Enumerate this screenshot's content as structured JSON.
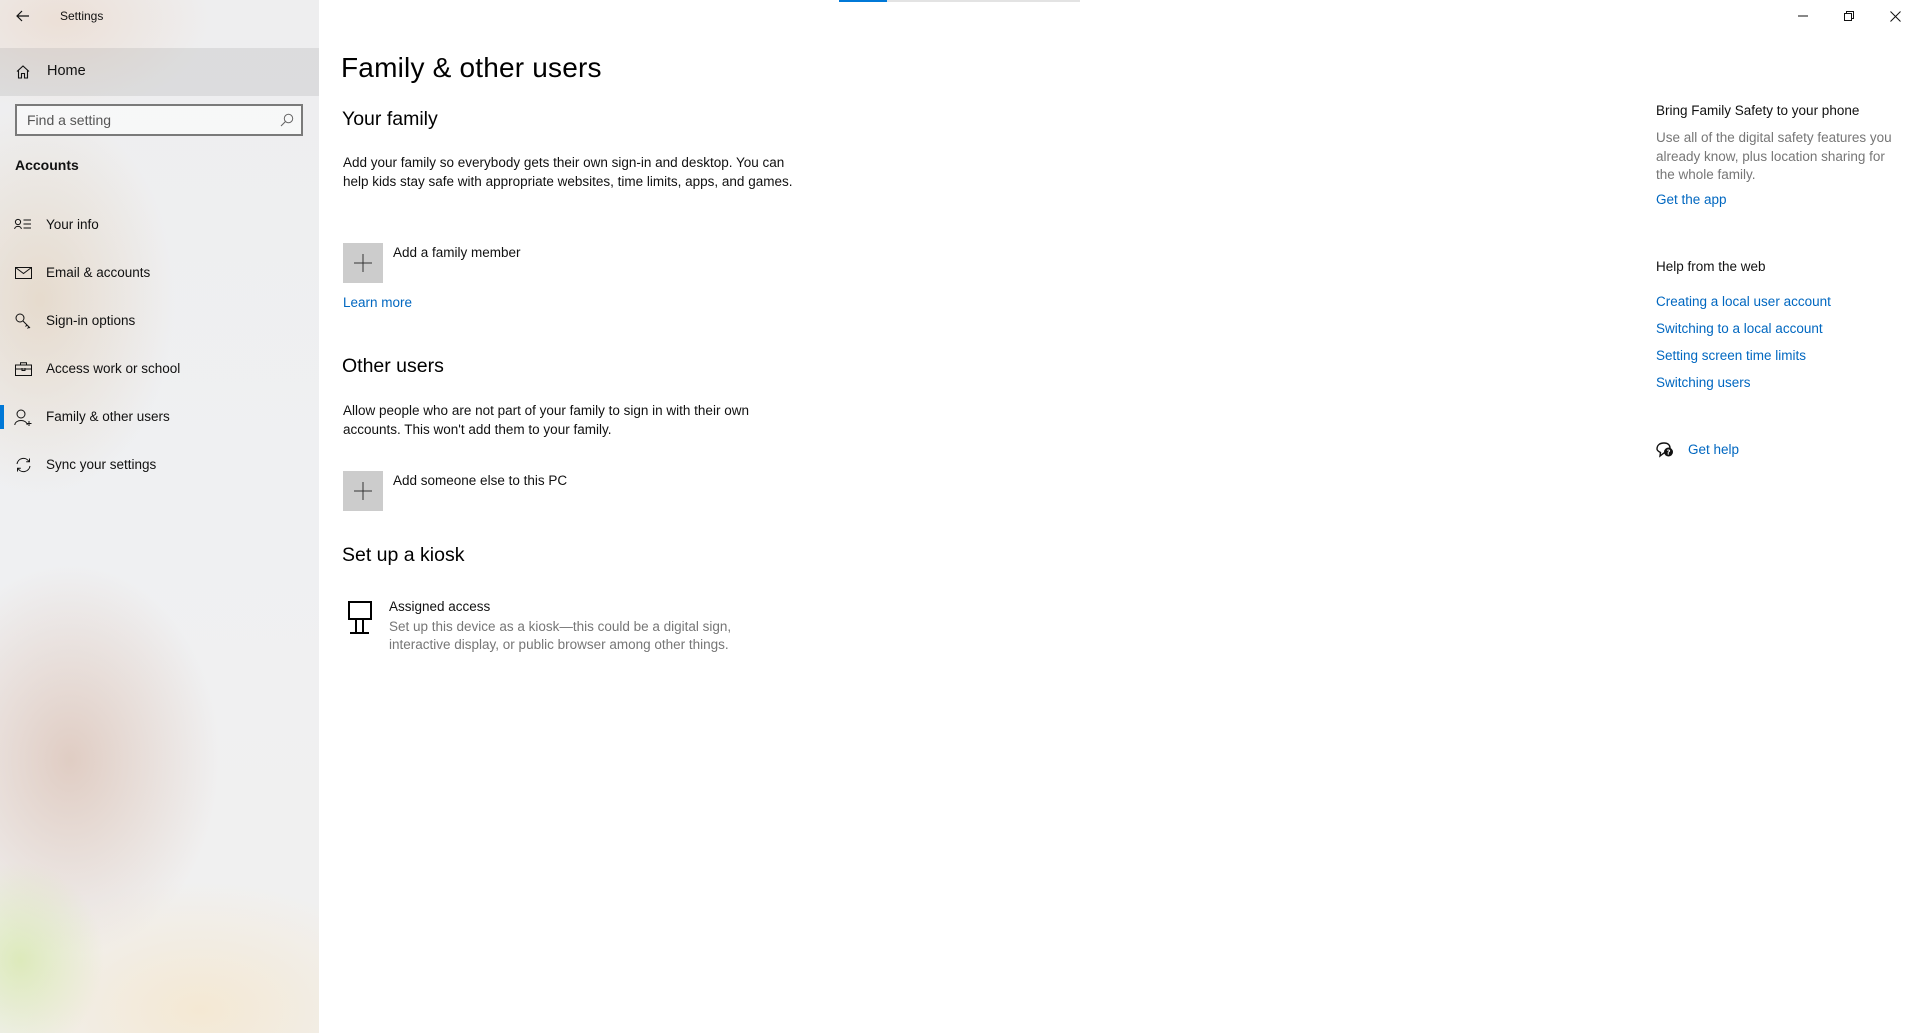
{
  "window": {
    "title": "Settings",
    "controls": {
      "minimize_icon": "minimize-icon",
      "restore_icon": "restore-icon",
      "close_icon": "close-icon"
    },
    "loading_progress_percent": 20
  },
  "colors": {
    "accent": "#0078d7",
    "link": "#0067c0",
    "tile_bg": "#cccccc",
    "secondary_text": "#767676"
  },
  "sidebar": {
    "back_icon": "back-arrow-icon",
    "home": {
      "label": "Home",
      "icon": "home-icon"
    },
    "search": {
      "placeholder": "Find a setting",
      "value": "",
      "icon": "search-icon"
    },
    "section_label": "Accounts",
    "items": [
      {
        "label": "Your info",
        "icon": "contact-info-icon",
        "selected": false
      },
      {
        "label": "Email & accounts",
        "icon": "mail-icon",
        "selected": false
      },
      {
        "label": "Sign-in options",
        "icon": "key-icon",
        "selected": false
      },
      {
        "label": "Access work or school",
        "icon": "briefcase-icon",
        "selected": false
      },
      {
        "label": "Family & other users",
        "icon": "add-person-icon",
        "selected": true
      },
      {
        "label": "Sync your settings",
        "icon": "sync-icon",
        "selected": false
      }
    ]
  },
  "main": {
    "page_title": "Family & other users",
    "your_family": {
      "heading": "Your family",
      "description": "Add your family so everybody gets their own sign-in and desktop. You can help kids stay safe with appropriate websites, time limits, apps, and games.",
      "add_button_label": "Add a family member",
      "learn_more": "Learn more"
    },
    "other_users": {
      "heading": "Other users",
      "description": "Allow people who are not part of your family to sign in with their own accounts. This won't add them to your family.",
      "add_button_label": "Add someone else to this PC"
    },
    "kiosk": {
      "heading": "Set up a kiosk",
      "item_title": "Assigned access",
      "item_description": "Set up this device as a kiosk—this could be a digital sign, interactive display, or public browser among other things."
    }
  },
  "aside": {
    "family_safety": {
      "heading": "Bring Family Safety to your phone",
      "description": "Use all of the digital safety features you already know, plus location sharing for the whole family.",
      "link": "Get the app"
    },
    "help_from_web": {
      "heading": "Help from the web",
      "links": [
        "Creating a local user account",
        "Switching to a local account",
        "Setting screen time limits",
        "Switching users"
      ]
    },
    "get_help": {
      "label": "Get help",
      "icon": "get-help-icon"
    }
  }
}
